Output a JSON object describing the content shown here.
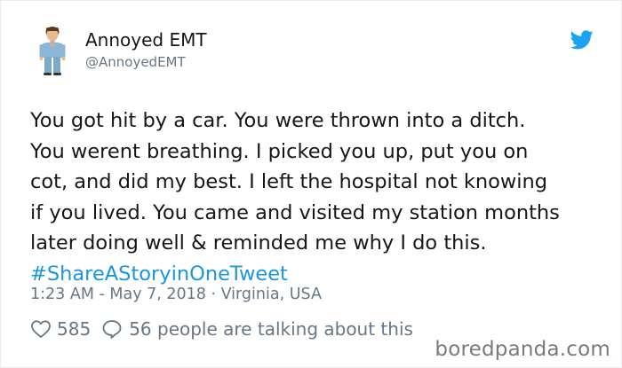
{
  "user": {
    "display_name": "Annoyed EMT",
    "handle": "@AnnoyedEMT"
  },
  "tweet": {
    "lines": [
      "You got hit by a car. You were thrown into a ditch.",
      "You werent breathing. I picked you up, put you on",
      "cot, and did my best. I left the hospital not knowing",
      "if you lived. You came and visited my station months",
      "later doing well & reminded me why I do this."
    ],
    "hashtag": "#ShareAStoryinOneTweet"
  },
  "meta": {
    "timestamp_location": "1:23 AM - May 7, 2018 · Virginia, USA"
  },
  "engagement": {
    "likes": "585",
    "talking_about": "56 people are talking about this"
  },
  "watermark": "boredpanda.com",
  "icons": {
    "avatar": "emt-avatar",
    "brand": "twitter-bird-icon",
    "like": "heart-icon",
    "reply": "speech-bubble-icon"
  },
  "colors": {
    "text": "#14171a",
    "secondary": "#657786",
    "link": "#1b95e0",
    "twitter_blue": "#1da1f2"
  }
}
